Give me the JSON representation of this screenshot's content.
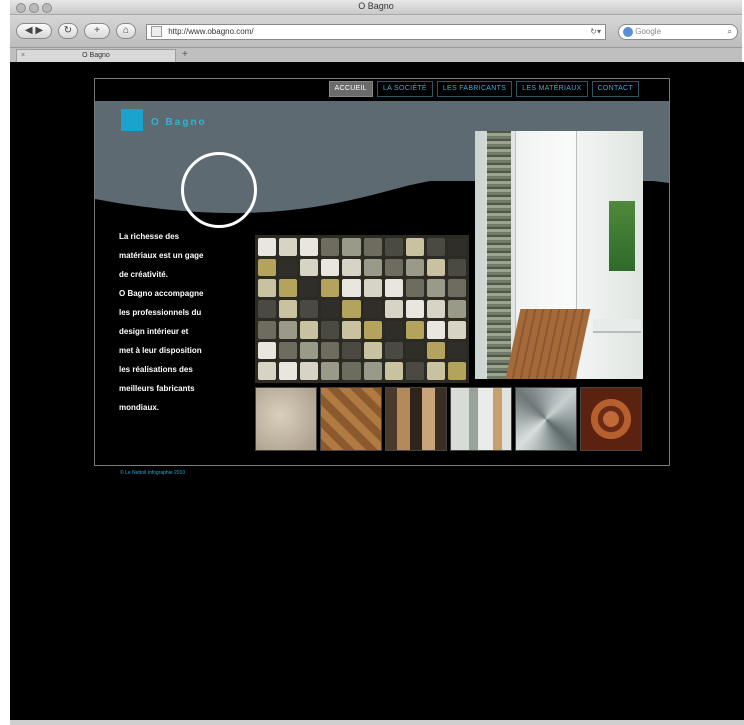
{
  "browser": {
    "window_title": "O Bagno",
    "url": "http://www.obagno.com/",
    "search_placeholder": "Google",
    "tab_label": "O Bagno",
    "new_tab": "+"
  },
  "site": {
    "logo_text": "O Bagno",
    "nav": [
      {
        "label": "Accueil",
        "active": true
      },
      {
        "label": "La société",
        "active": false
      },
      {
        "label": "Les fabricants",
        "active": false
      },
      {
        "label": "Les matériaux",
        "active": false
      },
      {
        "label": "Contact",
        "active": false
      }
    ],
    "intro": [
      "La richesse des",
      "matériaux est un gage",
      "de créativité.",
      "O Bagno accompagne",
      "les professionnels du",
      "design intérieur et",
      "met à leur disposition",
      "les réalisations des",
      "meilleurs fabricants",
      "mondiaux."
    ],
    "copyright": "© Le Nettoil Infographie 2010",
    "colors": {
      "accent": "#1aa3cc",
      "header_band": "#5d6a72",
      "background": "#000000"
    }
  }
}
